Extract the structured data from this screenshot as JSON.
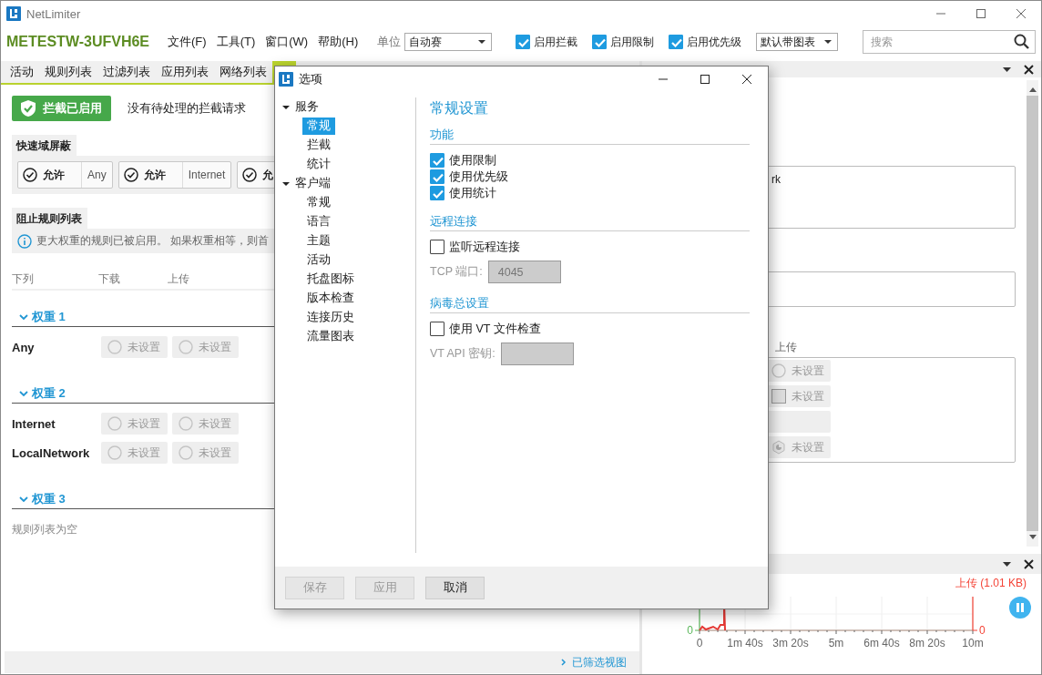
{
  "window": {
    "title": "NetLimiter"
  },
  "toolbar": {
    "machine": "METESTW-3UFVH6E",
    "menus": [
      "文件(F)",
      "工具(T)",
      "窗口(W)",
      "帮助(H)"
    ],
    "unit_label": "单位",
    "unit_value": "自动赛",
    "toggles": [
      {
        "label": "启用拦截",
        "checked": true
      },
      {
        "label": "启用限制",
        "checked": true
      },
      {
        "label": "启用优先级",
        "checked": true
      }
    ],
    "chart_select": "默认带图表",
    "search": {
      "placeholder": "搜索"
    }
  },
  "tabs": [
    {
      "label": "活动",
      "selected": false
    },
    {
      "label": "规则列表",
      "selected": false
    },
    {
      "label": "过滤列表",
      "selected": false
    },
    {
      "label": "应用列表",
      "selected": false
    },
    {
      "label": "网络列表",
      "selected": false
    },
    {
      "selected": true
    }
  ],
  "blocker": {
    "status_button": "拦截已启用",
    "message": "没有待处理的拦截请求",
    "quick_block": {
      "title": "快速域屏蔽",
      "items": [
        {
          "action": "允许",
          "target": "Any"
        },
        {
          "action": "允许",
          "target": "Internet"
        },
        {
          "action": "允"
        }
      ]
    },
    "rule_list": {
      "title": "阻止规则列表",
      "info": "更大权重的规则已被启用。 如果权重相等，则首",
      "columns": [
        "下列",
        "下载",
        "上传"
      ],
      "groups": [
        {
          "title": "权重 1",
          "expanded": true,
          "rows": [
            {
              "name": "Any",
              "download": "未设置",
              "upload": "未设置"
            }
          ]
        },
        {
          "title": "权重 2",
          "expanded": true,
          "rows": [
            {
              "name": "Internet",
              "download": "未设置",
              "upload": "未设置"
            },
            {
              "name": "LocalNetwork",
              "download": "未设置",
              "upload": "未设置"
            }
          ]
        },
        {
          "title": "权重 3",
          "expanded": true
        }
      ],
      "empty_text": "规则列表为空"
    }
  },
  "footer": {
    "link": "已筛选视图"
  },
  "side_panel": {
    "fragment": "rk",
    "column": "上传",
    "chips": [
      {
        "kind": "radio",
        "label": "未设置"
      },
      {
        "kind": "square",
        "label": "未设置"
      },
      {
        "kind": "blank"
      },
      {
        "kind": "hexagon",
        "label": "未设置"
      }
    ]
  },
  "graph": {
    "legend": "上传 (1.01 KB)",
    "left_axis": "0",
    "right_axis": "0",
    "x_labels": [
      "0",
      "1m 40s",
      "3m 20s",
      "5m",
      "6m 40s",
      "8m 20s",
      "10m"
    ]
  },
  "dialog": {
    "title": "选项",
    "tree": [
      {
        "label": "服务",
        "expanded": true,
        "selected": false,
        "children": [
          {
            "label": "常规",
            "selected": true
          },
          {
            "label": "拦截",
            "selected": false
          },
          {
            "label": "统计",
            "selected": false
          }
        ]
      },
      {
        "label": "客户端",
        "expanded": true,
        "selected": false,
        "children": [
          {
            "label": "常规",
            "selected": false
          },
          {
            "label": "语言",
            "selected": false
          },
          {
            "label": "主题",
            "selected": false
          },
          {
            "label": "活动",
            "selected": false
          },
          {
            "label": "托盘图标",
            "selected": false
          },
          {
            "label": "版本检查",
            "selected": false
          },
          {
            "label": "连接历史",
            "selected": false
          },
          {
            "label": "流量图表",
            "selected": false
          }
        ]
      }
    ],
    "heading": "常规设置",
    "sections": [
      {
        "title": "功能",
        "items": [
          {
            "kind": "checkbox",
            "label": "使用限制",
            "checked": true
          },
          {
            "kind": "checkbox",
            "label": "使用优先级",
            "checked": true
          },
          {
            "kind": "checkbox",
            "label": "使用统计",
            "checked": true
          }
        ]
      },
      {
        "title": "远程连接",
        "items": [
          {
            "kind": "checkbox",
            "label": "监听远程连接",
            "checked": false
          },
          {
            "kind": "field",
            "label": "TCP 端口:",
            "value": "4045",
            "disabled": true
          }
        ]
      },
      {
        "title": "病毒总设置",
        "items": [
          {
            "kind": "checkbox",
            "label": "使用 VT 文件检查",
            "checked": false
          },
          {
            "kind": "field",
            "label": "VT API 密钥:",
            "disabled": true
          }
        ]
      }
    ],
    "buttons": [
      {
        "label": "保存",
        "disabled": true
      },
      {
        "label": "应用",
        "disabled": true
      },
      {
        "label": "取消",
        "disabled": false
      }
    ]
  }
}
